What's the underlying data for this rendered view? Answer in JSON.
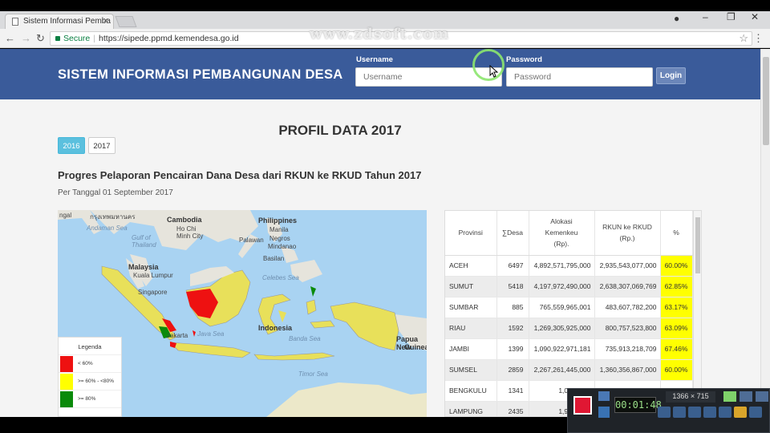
{
  "browser": {
    "tab_title": "Sistem Informasi Pemba",
    "tab_close": "×",
    "secure_label": "Secure",
    "url": "https://sipede.ppmd.kemendesa.go.id",
    "watermark": "www.zdsoft.com"
  },
  "header": {
    "site_title": "SISTEM INFORMASI PEMBANGUNAN DESA",
    "username_label": "Username",
    "username_placeholder": "Username",
    "password_label": "Password",
    "password_placeholder": "Password",
    "login_label": "Login"
  },
  "profile": {
    "title": "PROFIL DATA 2017",
    "years": [
      "2016",
      "2017"
    ],
    "active_year": "2016",
    "report_title": "Progres Pelaporan Pencairan Dana Desa dari RKUN ke RKUD Tahun 2017",
    "report_date": "Per Tanggal 01 September 2017"
  },
  "map": {
    "labels": {
      "cambodia": "Cambodia",
      "philippines": "Philippines",
      "malaysia": "Malaysia",
      "singapore": "Singapore",
      "indonesia": "Indonesia",
      "papua": "Papua New",
      "papua2": "Guinea",
      "hochi": "Ho Chi",
      "minh": "Minh City",
      "manila": "Manila",
      "palawan": "Palawan",
      "negros": "Negros",
      "mindanao": "Mindanao",
      "basilan": "Basilan",
      "kl": "Kuala Lumpur",
      "celebes": "Celebes Sea",
      "javasea": "Java Sea",
      "bandasea": "Banda Sea",
      "timorsea": "Timor Sea",
      "andaman": "Andaman Sea",
      "gulf": "Gulf of",
      "thailand": "Thailand",
      "jakarta": "Jakarta",
      "thai": "กรุงเทพมหานคร",
      "ngal": "ngal"
    },
    "legend": {
      "title": "Legenda",
      "items": [
        {
          "label": "< 60%",
          "color": "#ee1111"
        },
        {
          "label": ">= 60% - <80%",
          "color": "#ffff00"
        },
        {
          "label": ">= 80%",
          "color": "#0a8a0a"
        }
      ]
    }
  },
  "table": {
    "headers": {
      "provinsi": "Provinsi",
      "desa": "∑Desa",
      "alokasi": "Alokasi Kemenkeu (Rp).",
      "rkun": "RKUN ke RKUD (Rp.)",
      "pct": "%"
    },
    "highlight_color": "#ffff00",
    "rows": [
      {
        "prov": "ACEH",
        "desa": "6497",
        "alokasi": "4,892,571,795,000",
        "rkun": "2,935,543,077,000",
        "pct": "60.00%"
      },
      {
        "prov": "SUMUT",
        "desa": "5418",
        "alokasi": "4,197,972,490,000",
        "rkun": "2,638,307,069,769",
        "pct": "62.85%"
      },
      {
        "prov": "SUMBAR",
        "desa": "885",
        "alokasi": "765,559,965,001",
        "rkun": "483,607,782,200",
        "pct": "63.17%"
      },
      {
        "prov": "RIAU",
        "desa": "1592",
        "alokasi": "1,269,305,925,000",
        "rkun": "800,757,523,800",
        "pct": "63.09%"
      },
      {
        "prov": "JAMBI",
        "desa": "1399",
        "alokasi": "1,090,922,971,181",
        "rkun": "735,913,218,709",
        "pct": "67.46%"
      },
      {
        "prov": "SUMSEL",
        "desa": "2859",
        "alokasi": "2,267,261,445,000",
        "rkun": "1,360,356,867,000",
        "pct": "60.00%"
      },
      {
        "prov": "BENGKULU",
        "desa": "1341",
        "alokasi": "1,035,340,",
        "rkun": "",
        "pct": ""
      },
      {
        "prov": "LAMPUNG",
        "desa": "2435",
        "alokasi": "1,957,487,",
        "rkun": "",
        "pct": ""
      }
    ]
  },
  "recorder": {
    "time": "00:01:48",
    "resolution": "1366 × 715"
  }
}
